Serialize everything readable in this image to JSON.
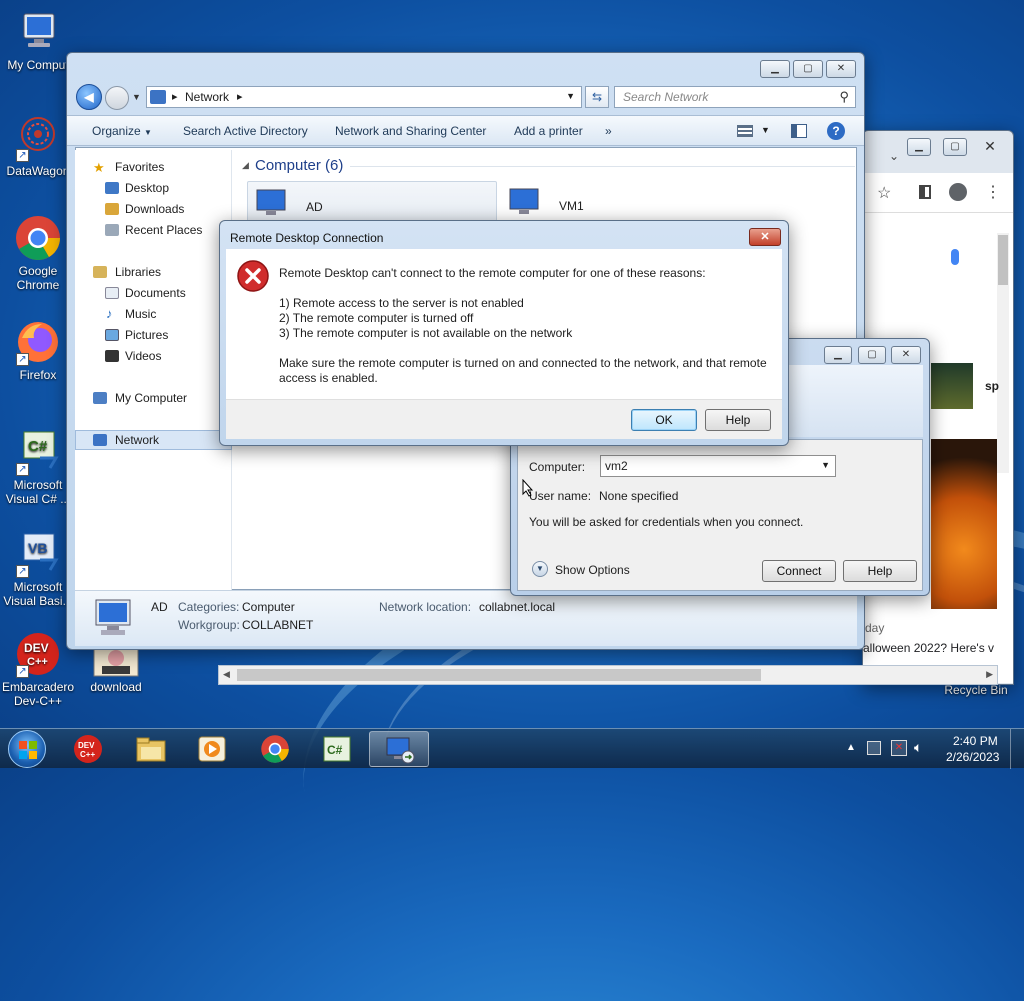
{
  "desktop": {
    "icons": [
      {
        "label": "My Comput"
      },
      {
        "label": "DataWagon"
      },
      {
        "label": "Google Chrome"
      },
      {
        "label": "Firefox"
      },
      {
        "label": "Microsoft Visual C# ..."
      },
      {
        "label": "Microsoft Visual Basi..."
      },
      {
        "label": "Embarcadero Dev-C++"
      },
      {
        "label": "download"
      },
      {
        "label": "Recycle Bin"
      }
    ]
  },
  "explorer": {
    "breadcrumb": "Network",
    "search_placeholder": "Search Network",
    "toolbar": [
      "Organize",
      "Search Active Directory",
      "Network and Sharing Center",
      "Add a printer",
      "»"
    ],
    "nav": {
      "favorites": "Favorites",
      "desktop": "Desktop",
      "downloads": "Downloads",
      "recent": "Recent Places",
      "libraries": "Libraries",
      "documents": "Documents",
      "music": "Music",
      "pictures": "Pictures",
      "videos": "Videos",
      "mycomputer": "My Computer",
      "network": "Network"
    },
    "group_header": "Computer (6)",
    "computers": [
      "AD",
      "VM1"
    ],
    "status": {
      "name": "AD",
      "categories_label": "Categories:",
      "categories_value": "Computer",
      "workgroup_label": "Workgroup:",
      "workgroup_value": "COLLABNET",
      "netloc_label": "Network location:",
      "netloc_value": "collabnet.local"
    }
  },
  "rdc": {
    "computer_label": "Computer:",
    "computer_value": "vm2",
    "user_label": "User name:",
    "user_value": "None specified",
    "credentials_note": "You will be asked for credentials when you connect.",
    "show_options": "Show Options",
    "connect": "Connect",
    "help": "Help"
  },
  "error_dialog": {
    "title": "Remote Desktop Connection",
    "message": "Remote Desktop can't connect to the remote computer for one of these reasons:",
    "reasons": [
      "1) Remote access to the server is not enabled",
      "2) The remote computer is turned off",
      "3) The remote computer is not available on the network"
    ],
    "advice_1": "Make sure the remote computer is turned on and connected to the network, and that remote",
    "advice_2": "access is enabled.",
    "ok": "OK",
    "help": "Help"
  },
  "chrome": {
    "partial_1": "sp",
    "partial_2": "day",
    "partial_3": "alloween 2022? Here's v"
  },
  "taskbar": {
    "time": "2:40 PM",
    "date": "2/26/2023"
  }
}
